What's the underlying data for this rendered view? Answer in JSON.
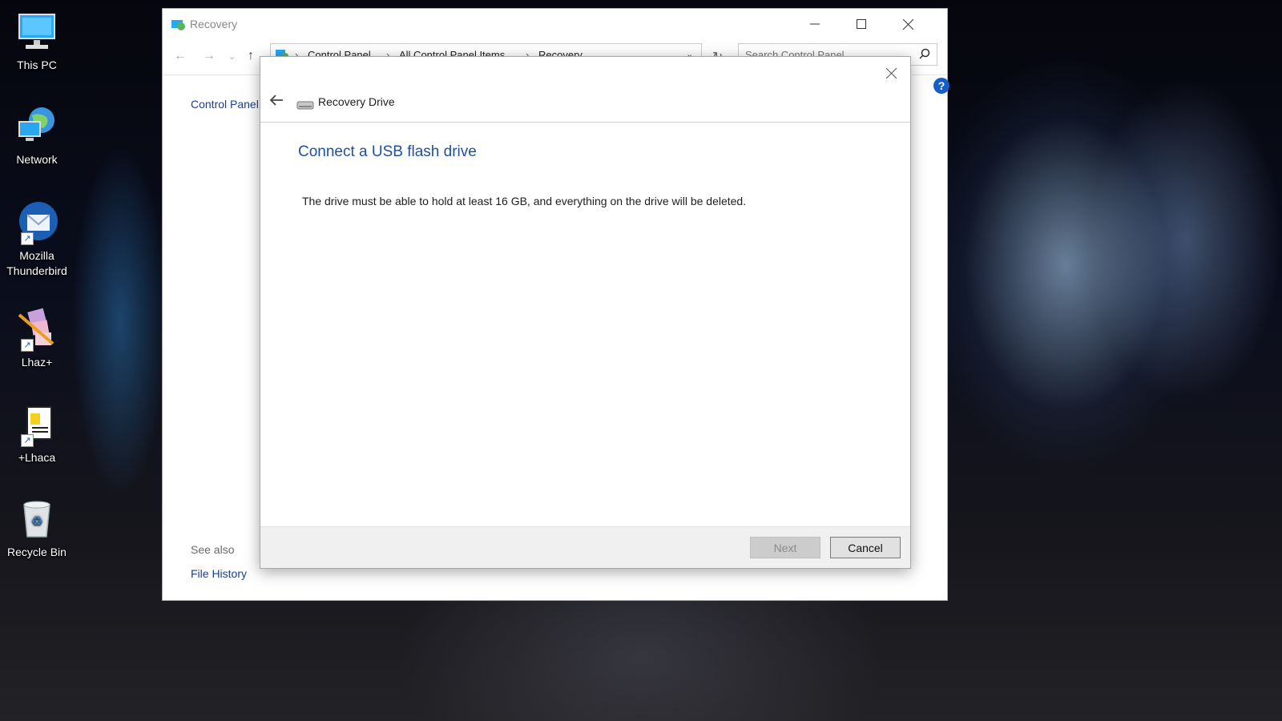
{
  "desktop": {
    "icons": [
      {
        "label": "This PC"
      },
      {
        "label": "Network"
      },
      {
        "label": "Mozilla Thunderbird"
      },
      {
        "label": "Lhaz+"
      },
      {
        "label": "+Lhaca"
      },
      {
        "label": "Recycle Bin"
      }
    ]
  },
  "control_panel": {
    "title": "Recovery",
    "breadcrumb": [
      "Control Panel",
      "All Control Panel Items",
      "Recovery"
    ],
    "search_placeholder": "Search Control Panel",
    "left_link": "Control Panel",
    "see_also": "See also",
    "file_history": "File History",
    "help": "?"
  },
  "dialog": {
    "title": "Recovery Drive",
    "heading": "Connect a USB flash drive",
    "message": "The drive must be able to hold at least 16 GB, and everything on the drive will be deleted.",
    "next_label": "Next",
    "cancel_label": "Cancel"
  },
  "colors": {
    "heading_blue": "#1e50a2",
    "link_blue": "#1a3f8f",
    "help_blue": "#1560c8"
  }
}
